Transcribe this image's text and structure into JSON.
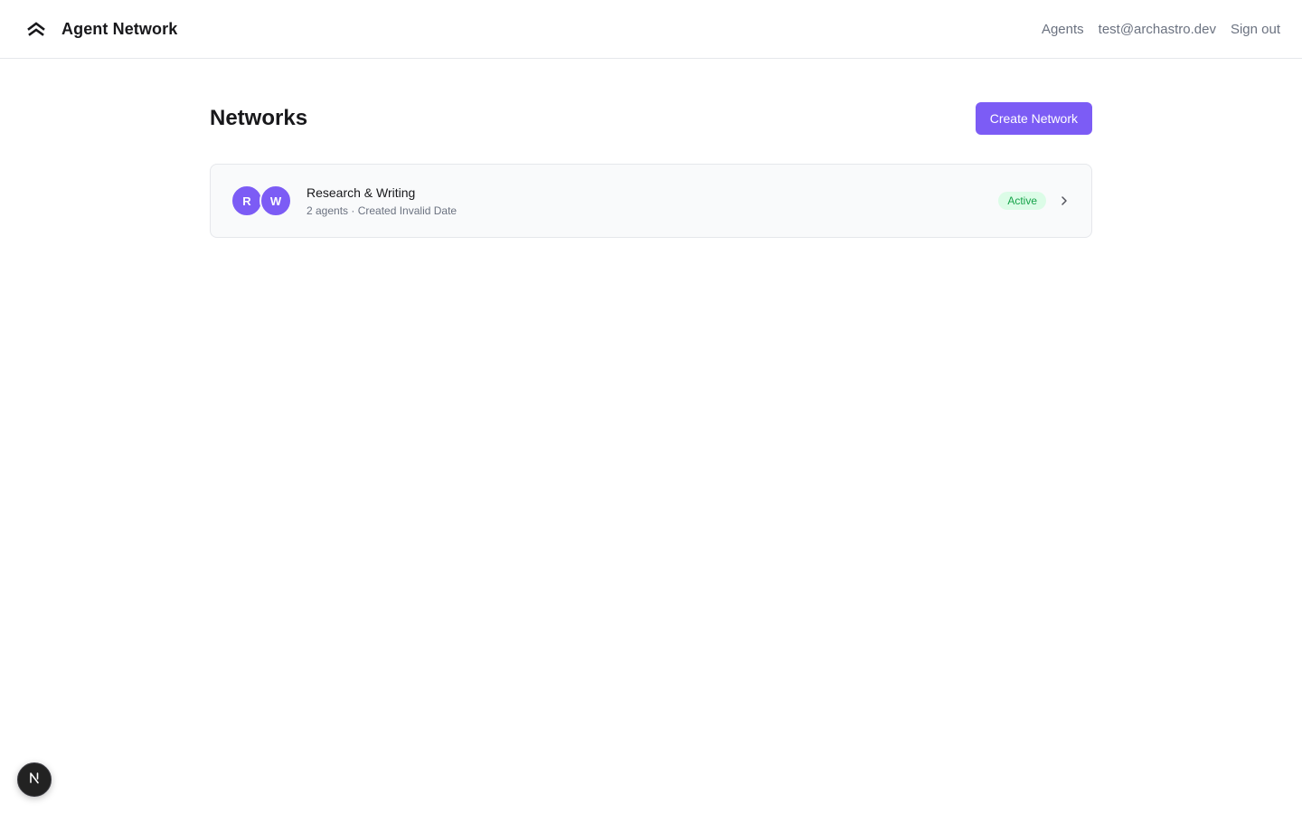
{
  "header": {
    "app_name": "Agent Network",
    "logo_icon": "chevron-up-double-icon",
    "nav": {
      "agents_label": "Agents",
      "user_email": "test@archastro.dev",
      "sign_out_label": "Sign out"
    }
  },
  "main": {
    "title": "Networks",
    "create_button_label": "Create Network",
    "networks": [
      {
        "name": "Research & Writing",
        "avatars": [
          "R",
          "W"
        ],
        "meta": "2 agents · Created Invalid Date",
        "status": "Active"
      }
    ]
  },
  "dev_badge": {
    "label": "N",
    "icon": "nextjs-icon"
  },
  "colors": {
    "accent": "#7c5cf5",
    "status_active_bg": "#dcfce7",
    "status_active_text": "#16a34a"
  }
}
